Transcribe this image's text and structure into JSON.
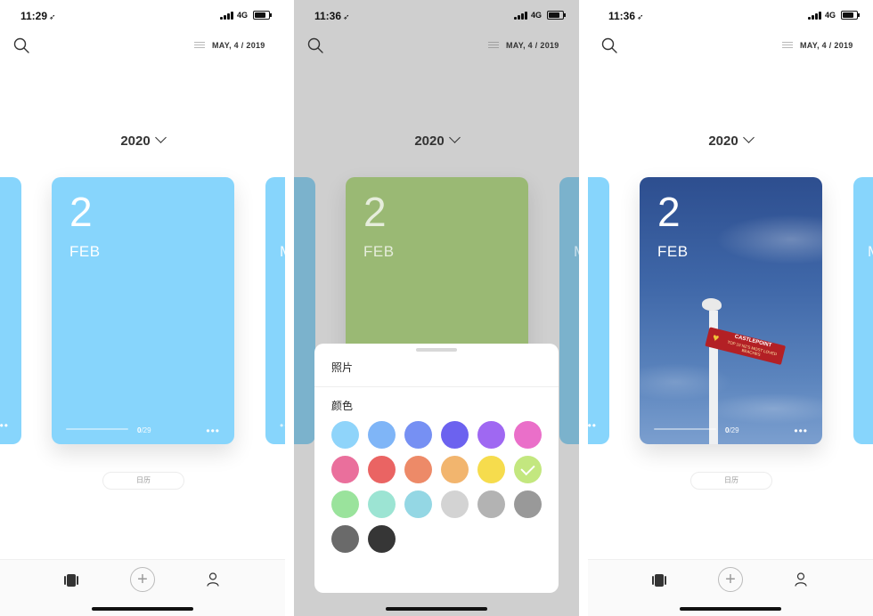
{
  "screens": [
    {
      "status": {
        "time": "11:29",
        "network": "4G"
      },
      "header": {
        "date": "MAY, 4 / 2019"
      },
      "year": "2020",
      "card": {
        "day": "2",
        "month": "FEB",
        "count_current": "0",
        "count_total": "/29",
        "more": "•••",
        "color": "#87d5fc"
      },
      "side_cards": {
        "left_color": "#87d5fc",
        "right_color": "#87d5fc",
        "right_letter": "M"
      },
      "calendar_pill": "日历"
    },
    {
      "status": {
        "time": "11:36",
        "network": "4G"
      },
      "header": {
        "date": "MAY, 4 / 2019"
      },
      "year": "2020",
      "card": {
        "day": "2",
        "month": "FEB",
        "color": "#9ab974"
      },
      "side_cards": {
        "left_color": "#7bb2cc",
        "right_color": "#7bb2cc",
        "right_letter": "M"
      },
      "sheet": {
        "photo_label": "照片",
        "color_label": "颜色",
        "selected_index": 11,
        "swatches": [
          "#8fd4fa",
          "#7fb5f7",
          "#7690f3",
          "#6c62ef",
          "#9f68f2",
          "#ea6fc9",
          "#ea6f9c",
          "#ea6463",
          "#ed8a68",
          "#f2b56e",
          "#f6dc4d",
          "#c3e77f",
          "#9ae39c",
          "#9ce4d3",
          "#94d7e4",
          "#d3d3d3",
          "#b3b3b3",
          "#999999",
          "#6a6a6a",
          "#363636"
        ]
      }
    },
    {
      "status": {
        "time": "11:36",
        "network": "4G"
      },
      "header": {
        "date": "MAY, 4 / 2019"
      },
      "year": "2020",
      "card": {
        "day": "2",
        "month": "FEB",
        "count_current": "0",
        "count_total": "/29",
        "more": "•••",
        "photo_sign_title": "CASTLEPOINT",
        "photo_sign_sub": "TOP 10 NZ'S MOST LOVED BEACHES"
      },
      "side_cards": {
        "left_color": "#87d5fc",
        "right_color": "#87d5fc",
        "right_letter": "M"
      },
      "calendar_pill": "日历"
    }
  ]
}
